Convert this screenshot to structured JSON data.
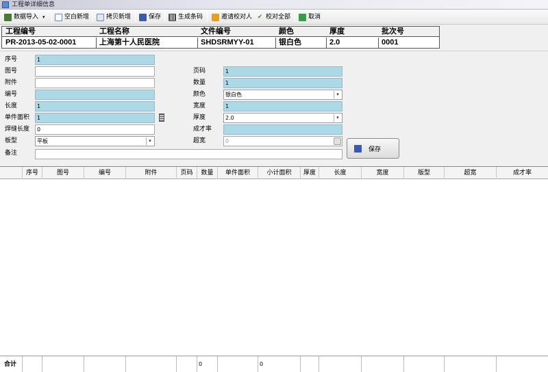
{
  "window": {
    "title": "工程单详细信息"
  },
  "toolbar": {
    "import": "数据导入",
    "blank_new": "空白新增",
    "copy_new": "拷贝新增",
    "save": "保存",
    "barcode": "生成条码",
    "invite": "邀请校对人",
    "check_all": "校对全部",
    "cancel": "取消"
  },
  "info": {
    "headers": [
      "工程编号",
      "工程名称",
      "文件编号",
      "颜色",
      "厚度",
      "批次号"
    ],
    "values": [
      "PR-2013-05-02-0001",
      "上海第十人民医院",
      "SHDSRMYY-01",
      "银白色",
      "2.0",
      "0001"
    ]
  },
  "form": {
    "seq": {
      "label": "序号",
      "value": "1"
    },
    "drawing": {
      "label": "图号",
      "value": ""
    },
    "attachment": {
      "label": "附件",
      "value": ""
    },
    "code": {
      "label": "编号",
      "value": ""
    },
    "length": {
      "label": "长度",
      "value": "1"
    },
    "unit_area": {
      "label": "单件面积",
      "value": "1"
    },
    "weld_length": {
      "label": "焊缝长度",
      "value": "0"
    },
    "plate_type": {
      "label": "板型",
      "value": "平板"
    },
    "remark": {
      "label": "备注",
      "value": ""
    },
    "page": {
      "label": "页码",
      "value": "1"
    },
    "quantity": {
      "label": "数量",
      "value": "1"
    },
    "color": {
      "label": "颜色",
      "value": "银白色"
    },
    "width": {
      "label": "宽度",
      "value": "1"
    },
    "thickness": {
      "label": "厚度",
      "value": "2.0"
    },
    "yield_rate": {
      "label": "成才率",
      "value": ""
    },
    "overwidth": {
      "label": "超宽",
      "value": "0"
    },
    "save_button": "保存"
  },
  "grid": {
    "columns": [
      "序号",
      "图号",
      "编号",
      "附件",
      "页码",
      "数量",
      "单件面积",
      "小计面积",
      "厚度",
      "长度",
      "宽度",
      "版型",
      "超宽",
      "成才率"
    ],
    "footer": {
      "label": "合计",
      "quantity_total": "0",
      "subtotal_area_total": "0"
    }
  }
}
